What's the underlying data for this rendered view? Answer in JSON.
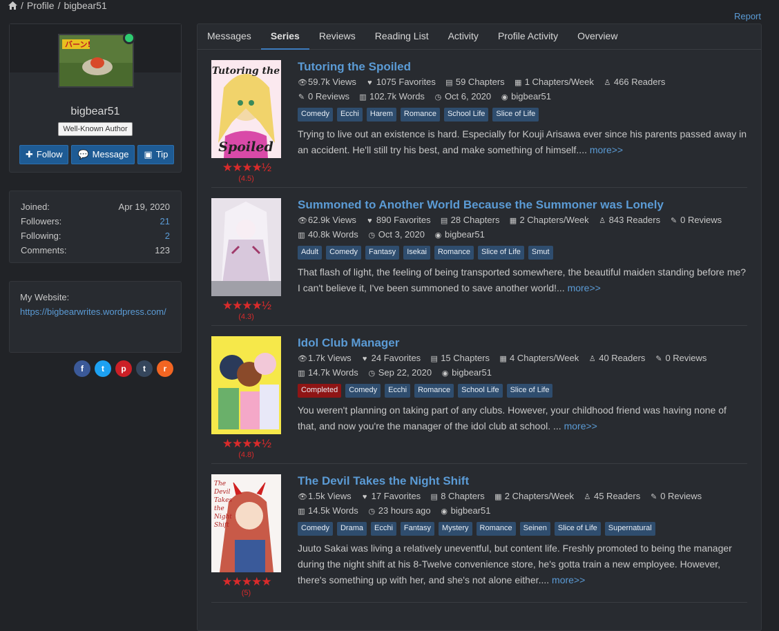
{
  "breadcrumb": {
    "home_icon": "home-icon",
    "items": [
      "Profile",
      "bigbear51"
    ],
    "separator": "/"
  },
  "report_label": "Report",
  "profile": {
    "username": "bigbear51",
    "role": "Well-Known Author",
    "status": "online",
    "buttons": {
      "follow": "Follow",
      "message": "Message",
      "tip": "Tip"
    },
    "stats": [
      {
        "label": "Joined:",
        "value": "Apr 19, 2020"
      },
      {
        "label": "Followers:",
        "value": "21"
      },
      {
        "label": "Following:",
        "value": "2"
      },
      {
        "label": "Comments:",
        "value": "123"
      }
    ],
    "website_label": "My Website:",
    "website_url": "https://bigbearwrites.wordpress.com/",
    "social": [
      {
        "icon": "facebook-icon",
        "glyph": "f",
        "color": "#3b5998"
      },
      {
        "icon": "twitter-icon",
        "glyph": "t",
        "color": "#1da1f2"
      },
      {
        "icon": "pinterest-icon",
        "glyph": "p",
        "color": "#cb2027"
      },
      {
        "icon": "tumblr-icon",
        "glyph": "t",
        "color": "#35465c"
      },
      {
        "icon": "rss-icon",
        "glyph": "r",
        "color": "#f26522"
      }
    ]
  },
  "tabs": [
    "Messages",
    "Series",
    "Reviews",
    "Reading List",
    "Activity",
    "Profile Activity",
    "Overview"
  ],
  "active_tab": "Series",
  "series": [
    {
      "title": "Tutoring the Spoiled",
      "cover_text": [
        "Tutoring the",
        "Spoiled"
      ],
      "rating": "(4.5)",
      "stars": "★★★★½",
      "row1": [
        "59.7k Views",
        "1075 Favorites",
        "59 Chapters",
        "1 Chapters/Week",
        "466 Readers"
      ],
      "row2": [
        "0 Reviews",
        "102.7k Words",
        "Oct 6, 2020",
        "bigbear51"
      ],
      "tags": [
        "Comedy",
        "Ecchi",
        "Harem",
        "Romance",
        "School Life",
        "Slice of Life"
      ],
      "completed": "",
      "desc": "Trying to live out an existence is hard. Especially for Kouji Arisawa ever since his parents passed away in an accident. He'll still try his best, and make something of himself....",
      "more": "more>>"
    },
    {
      "title": "Summoned to Another World Because the Summoner was Lonely",
      "cover_text": [],
      "rating": "(4.3)",
      "stars": "★★★★½",
      "row1": [
        "62.9k Views",
        "890 Favorites",
        "28 Chapters",
        "2 Chapters/Week",
        "843 Readers",
        "0 Reviews"
      ],
      "row2": [
        "40.8k Words",
        "Oct 3, 2020",
        "bigbear51"
      ],
      "tags": [
        "Adult",
        "Comedy",
        "Fantasy",
        "Isekai",
        "Romance",
        "Slice of Life",
        "Smut"
      ],
      "completed": "",
      "desc": "That flash of light, the feeling of being transported somewhere, the beautiful maiden standing before me? I can't believe it, I've been summoned to save another world!...",
      "more": "more>>"
    },
    {
      "title": "Idol Club Manager",
      "cover_text": [],
      "rating": "(4.8)",
      "stars": "★★★★½",
      "row1": [
        "1.7k Views",
        "24 Favorites",
        "15 Chapters",
        "4 Chapters/Week",
        "40 Readers",
        "0 Reviews"
      ],
      "row2": [
        "14.7k Words",
        "Sep 22, 2020",
        "bigbear51"
      ],
      "tags": [
        "Comedy",
        "Ecchi",
        "Romance",
        "School Life",
        "Slice of Life"
      ],
      "completed": "Completed",
      "desc": "You weren't planning on taking part of any clubs. However, your childhood friend was having none of that, and now you're the manager of the idol club at school. ...",
      "more": "more>>"
    },
    {
      "title": "The Devil Takes the Night Shift",
      "cover_text": [
        "The",
        "Devil",
        "Takes",
        "the",
        "Night",
        "Shift"
      ],
      "rating": "(5)",
      "stars": "★★★★★",
      "row1": [
        "1.5k Views",
        "17 Favorites",
        "8 Chapters",
        "2 Chapters/Week",
        "45 Readers",
        "0 Reviews"
      ],
      "row2": [
        "14.5k Words",
        "23 hours ago",
        "bigbear51"
      ],
      "tags": [
        "Comedy",
        "Drama",
        "Ecchi",
        "Fantasy",
        "Mystery",
        "Romance",
        "Seinen",
        "Slice of Life",
        "Supernatural"
      ],
      "completed": "",
      "desc": "Juuto Sakai was living a relatively uneventful, but content life. Freshly promoted to being the manager during the night shift at his 8-Twelve convenience store, he's gotta train a new employee. However, there's something up with her, and she's not alone either....",
      "more": "more>>"
    }
  ]
}
